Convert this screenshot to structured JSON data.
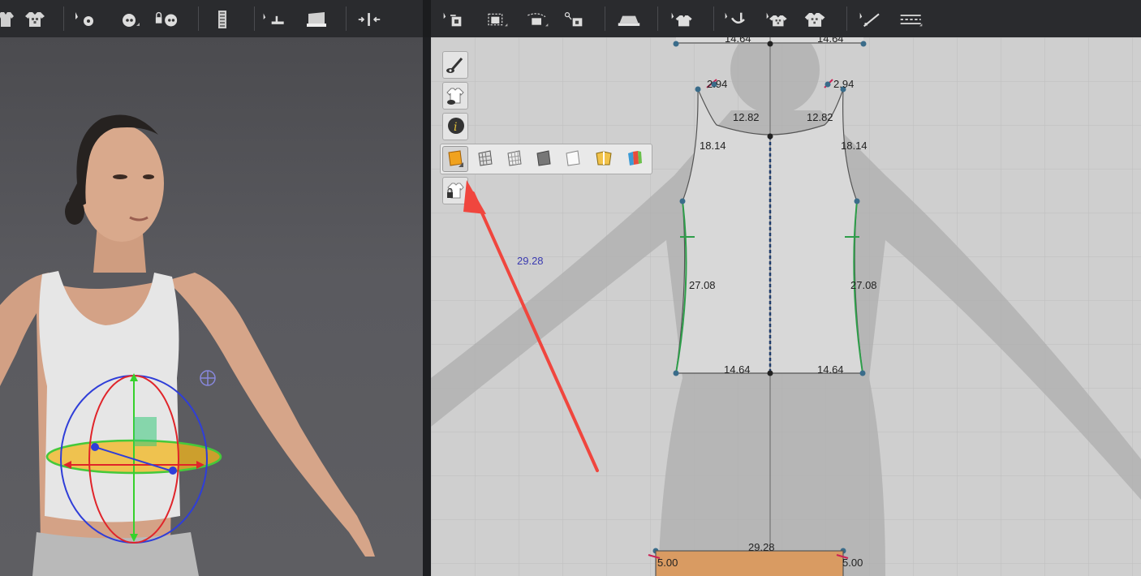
{
  "toolbar": {
    "left_icons": [
      "garment-icon",
      "garment-checker-icon",
      "select-point-icon",
      "circle-point-icon",
      "lock-point-icon",
      "zipper-icon",
      "select-seam-icon",
      "seam-segment-icon",
      "fold-tack-icon"
    ],
    "right_icons": [
      "edit-pattern-icon",
      "transform-pattern-icon",
      "curve-pattern-icon",
      "pin-pattern-icon",
      "iron-icon",
      "select-garment-icon",
      "tack-icon",
      "checker-garment-icon",
      "checker-garment-2-icon",
      "line-tool-icon",
      "dashed-line-tool-icon"
    ]
  },
  "side_tools": [
    "show-pattern-icon",
    "show-garment-icon",
    "info-icon",
    "texture-view-icon",
    "lock-garment-icon"
  ],
  "flyout_tools": [
    "texture-orange-icon",
    "mesh-view-icon",
    "grid-view-icon",
    "shaded-view-icon",
    "white-view-icon",
    "folded-view-icon",
    "colorful-view-icon"
  ],
  "measurements": {
    "top_left": "14.64",
    "top_right": "14.64",
    "shoulder_left": "2.94",
    "shoulder_right": "2.94",
    "neck_left": "12.82",
    "neck_right": "12.82",
    "armhole_left": "18.14",
    "armhole_right": "18.14",
    "side_left": "27.08",
    "side_right": "27.08",
    "hem_left": "14.64",
    "hem_right": "14.64",
    "total_width": "29.28",
    "band_width": "29.28",
    "band_left": "5.00",
    "band_right": "5.00"
  },
  "colors": {
    "toolbar": "#2a2b2e",
    "viewport_bg": "#58585c",
    "board_bg": "#cfcfcf",
    "pattern_fill": "#d8d8d8",
    "seam_green": "#2e9e4a",
    "band_orange": "#d99b62",
    "arrow_red": "#f0463e"
  }
}
